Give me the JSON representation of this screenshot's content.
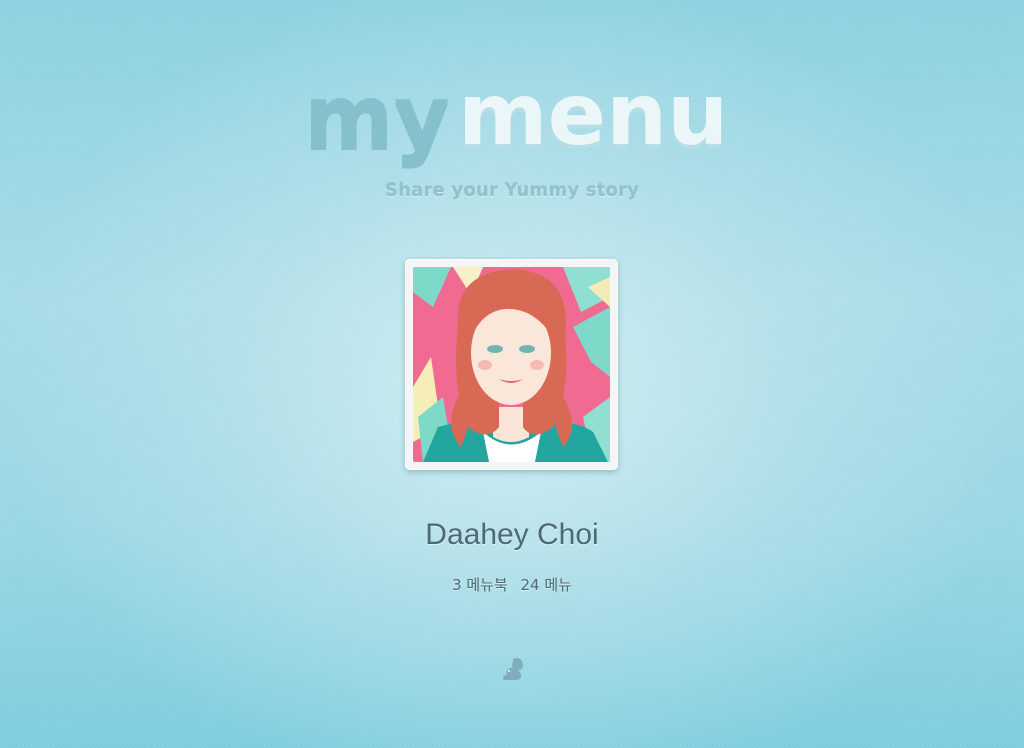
{
  "logo": {
    "part1": "my",
    "part2": "menu"
  },
  "tagline": "Share your Yummy story",
  "profile": {
    "name": "Daahey Choi",
    "menubook_count": "3 메뉴북",
    "menu_count": "24 메뉴"
  },
  "icons": {
    "footer": "squirrel-logo-icon"
  },
  "colors": {
    "background": "#9cd8e5",
    "logo_my": "#7fb9c6",
    "logo_menu": "#e6f4f6",
    "text": "#4e6a72"
  }
}
